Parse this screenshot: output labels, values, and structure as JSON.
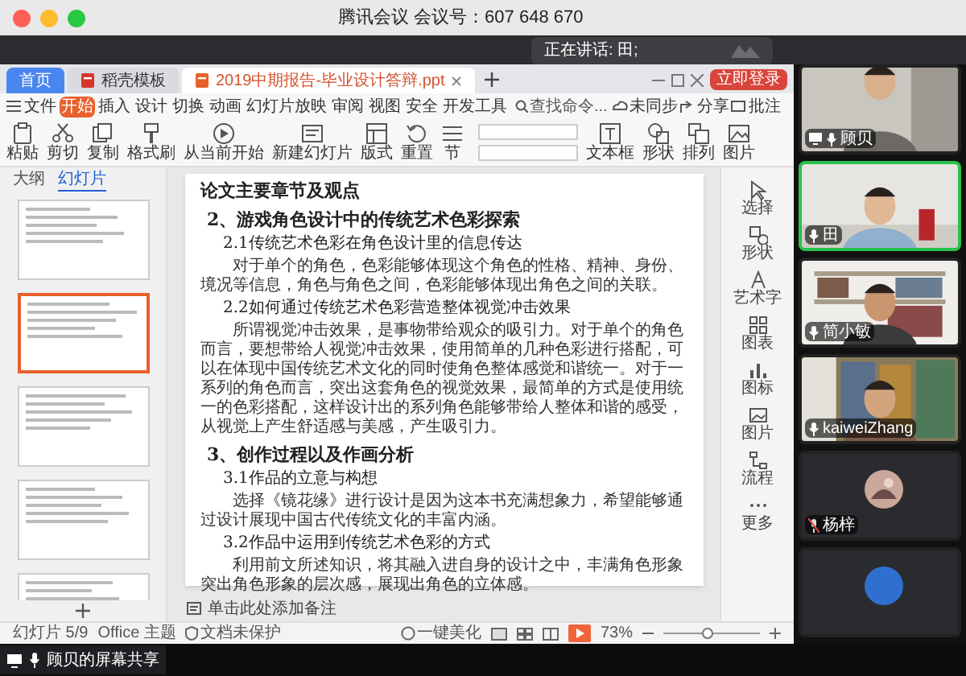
{
  "window": {
    "title": "腾讯会议 会议号：607 648 670"
  },
  "speaking_toast": {
    "text": "正在讲话: 田;"
  },
  "wps": {
    "tabs": [
      {
        "label": "首页",
        "kind": "home",
        "selected": false
      },
      {
        "label": "稻壳模板",
        "kind": "doc",
        "selected": false
      },
      {
        "label": "2019中期报告-毕业设计答辩.ppt",
        "kind": "doc",
        "selected": true
      }
    ],
    "login_button": "立即登录",
    "menu": [
      {
        "label": "文件",
        "selected": false
      },
      {
        "label": "开始",
        "selected": true
      },
      {
        "label": "插入",
        "selected": false
      },
      {
        "label": "设计",
        "selected": false
      },
      {
        "label": "切换",
        "selected": false
      },
      {
        "label": "动画",
        "selected": false
      },
      {
        "label": "幻灯片放映",
        "selected": false
      },
      {
        "label": "审阅",
        "selected": false
      },
      {
        "label": "视图",
        "selected": false
      },
      {
        "label": "安全",
        "selected": false
      },
      {
        "label": "开发工具",
        "selected": false
      }
    ],
    "search": {
      "placeholder": "查找命令..."
    },
    "menu_right": [
      "未同步",
      "分享",
      "批注"
    ],
    "toolbar": [
      "粘贴",
      "剪切",
      "复制",
      "格式刷",
      "从当前开始",
      "新建幻灯片",
      "版式",
      "重置",
      "节",
      "文本框",
      "形状",
      "排列",
      "图片"
    ],
    "thumbnail_tabs": [
      {
        "label": "大纲",
        "selected": false
      },
      {
        "label": "幻灯片",
        "selected": true
      }
    ],
    "thumbnails": [
      {
        "selected": false
      },
      {
        "selected": true
      },
      {
        "selected": false
      },
      {
        "selected": false
      },
      {
        "selected": false
      }
    ],
    "slide": {
      "title": "论文主要章节及观点",
      "sections": [
        {
          "heading": "2、游戏角色设计中的传统艺术色彩探索",
          "items": [
            {
              "subheading": "2.1传统艺术色彩在角色设计里的信息传达",
              "body": "对于单个的角色，色彩能够体现这个角色的性格、精神、身份、境况等信息，角色与角色之间，色彩能够体现出角色之间的关联。"
            },
            {
              "subheading": "2.2如何通过传统艺术色彩营造整体视觉冲击效果",
              "body": "所谓视觉冲击效果，是事物带给观众的吸引力。对于单个的角色而言，要想带给人视觉冲击效果，使用简单的几种色彩进行搭配，可以在体现中国传统艺术文化的同时使角色整体感觉和谐统一。对于一系列的角色而言，突出这套角色的视觉效果，最简单的方式是使用统一的色彩搭配，这样设计出的系列角色能够带给人整体和谐的感受，从视觉上产生舒适感与美感，产生吸引力。"
            }
          ]
        },
        {
          "heading": "3、创作过程以及作画分析",
          "items": [
            {
              "subheading": "3.1作品的立意与构想",
              "body": "选择《镜花缘》进行设计是因为这本书充满想象力，希望能够通过设计展现中国古代传统文化的丰富内涵。"
            },
            {
              "subheading": "3.2作品中运用到传统艺术色彩的方式",
              "body": "利用前文所述知识，将其融入进自身的设计之中，丰满角色形象突出角色形象的层次感，展现出角色的立体感。"
            }
          ]
        }
      ]
    },
    "notes_placeholder": "单击此处添加备注",
    "side_tools": [
      "选择",
      "形状",
      "艺术字",
      "图表",
      "图标",
      "图片",
      "流程",
      "更多"
    ],
    "status": {
      "slide_count": "幻灯片 5/9",
      "theme": "Office 主题",
      "protection": "文档未保护",
      "beautify": "一键美化",
      "zoom": "73%",
      "zoom_slider": {
        "level": 0.45
      }
    }
  },
  "participants": [
    {
      "name": "顾贝",
      "kind": "video",
      "sharing": true,
      "muted": false,
      "speaking": false
    },
    {
      "name": "田",
      "kind": "video",
      "sharing": false,
      "muted": false,
      "speaking": true
    },
    {
      "name": "简小敏",
      "kind": "video",
      "sharing": false,
      "muted": false,
      "speaking": false
    },
    {
      "name": "kaiweiZhang",
      "kind": "video",
      "sharing": false,
      "muted": false,
      "speaking": false
    },
    {
      "name": "杨梓",
      "kind": "avatar",
      "sharing": false,
      "muted": true,
      "speaking": false
    },
    {
      "kind": "avatar",
      "speaking": false
    }
  ],
  "share_label": "顾贝的屏幕共享"
}
